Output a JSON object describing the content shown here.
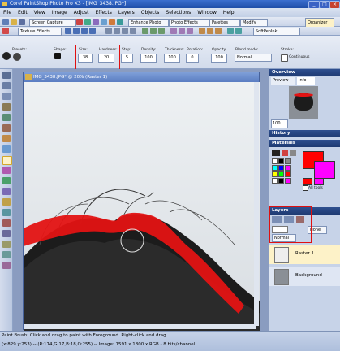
{
  "window": {
    "title": "Corel PaintShop Photo Pro X3 - [IMG_3438.JPG*]"
  },
  "menu": [
    "File",
    "Edit",
    "View",
    "Image",
    "Adjust",
    "Effects",
    "Layers",
    "Objects",
    "Selections",
    "Window",
    "Help"
  ],
  "toolbar": {
    "organizer_label": "Organizer",
    "screen_capture_label": "Screen Capture",
    "enhance_photo_label": "Enhance Photo",
    "photo_effects_label": "Photo Effects",
    "palettes_label": "Palettes",
    "modify_label": "Modify"
  },
  "toolbar2": {
    "texture_effects_label": "Texture Effects",
    "preset_value": "SoftPenInk"
  },
  "tool_options": {
    "labels": {
      "presets": "Presets:",
      "shape": "Shape:",
      "size": "Size:",
      "hardness": "Hardness:",
      "step": "Step:",
      "density": "Density:",
      "thickness": "Thickness:",
      "rotation": "Rotation:",
      "opacity": "Opacity:",
      "blend_mode": "Blend mode:",
      "stroke": "Stroke:",
      "continuous": "Continuous"
    },
    "size": "38",
    "hardness": "20",
    "step": "5",
    "density": "100",
    "thickness": "100",
    "rotation": "0",
    "opacity": "100",
    "blend_mode": "Normal"
  },
  "document": {
    "title": "IMG_3438.JPG* @ 20% (Raster 1)"
  },
  "overview": {
    "title": "Overview",
    "tab_preview": "Preview",
    "tab_info": "Info",
    "zoom": "100"
  },
  "history": {
    "title": "History"
  },
  "materials": {
    "title": "Materials",
    "all_tools_label": "All tools",
    "foreground_color": "#ff0000",
    "background_color": "#ff00ff"
  },
  "layers": {
    "title": "Layers",
    "blend": "Normal",
    "opacity_label": "None",
    "items": [
      {
        "name": "Raster 1"
      },
      {
        "name": "Background"
      }
    ]
  },
  "status": {
    "line1": "Paint Brush: Click and drag to paint with Foreground. Right-click and drag",
    "line2": "(x:829 y:253) -- (R:174,G:17,B:18,O:255) -- Image: 1591 x 1800 x RGB - 8 bits/channel"
  },
  "colors": {
    "accent_red": "#e01010",
    "title_blue": "#1f4ea8"
  }
}
